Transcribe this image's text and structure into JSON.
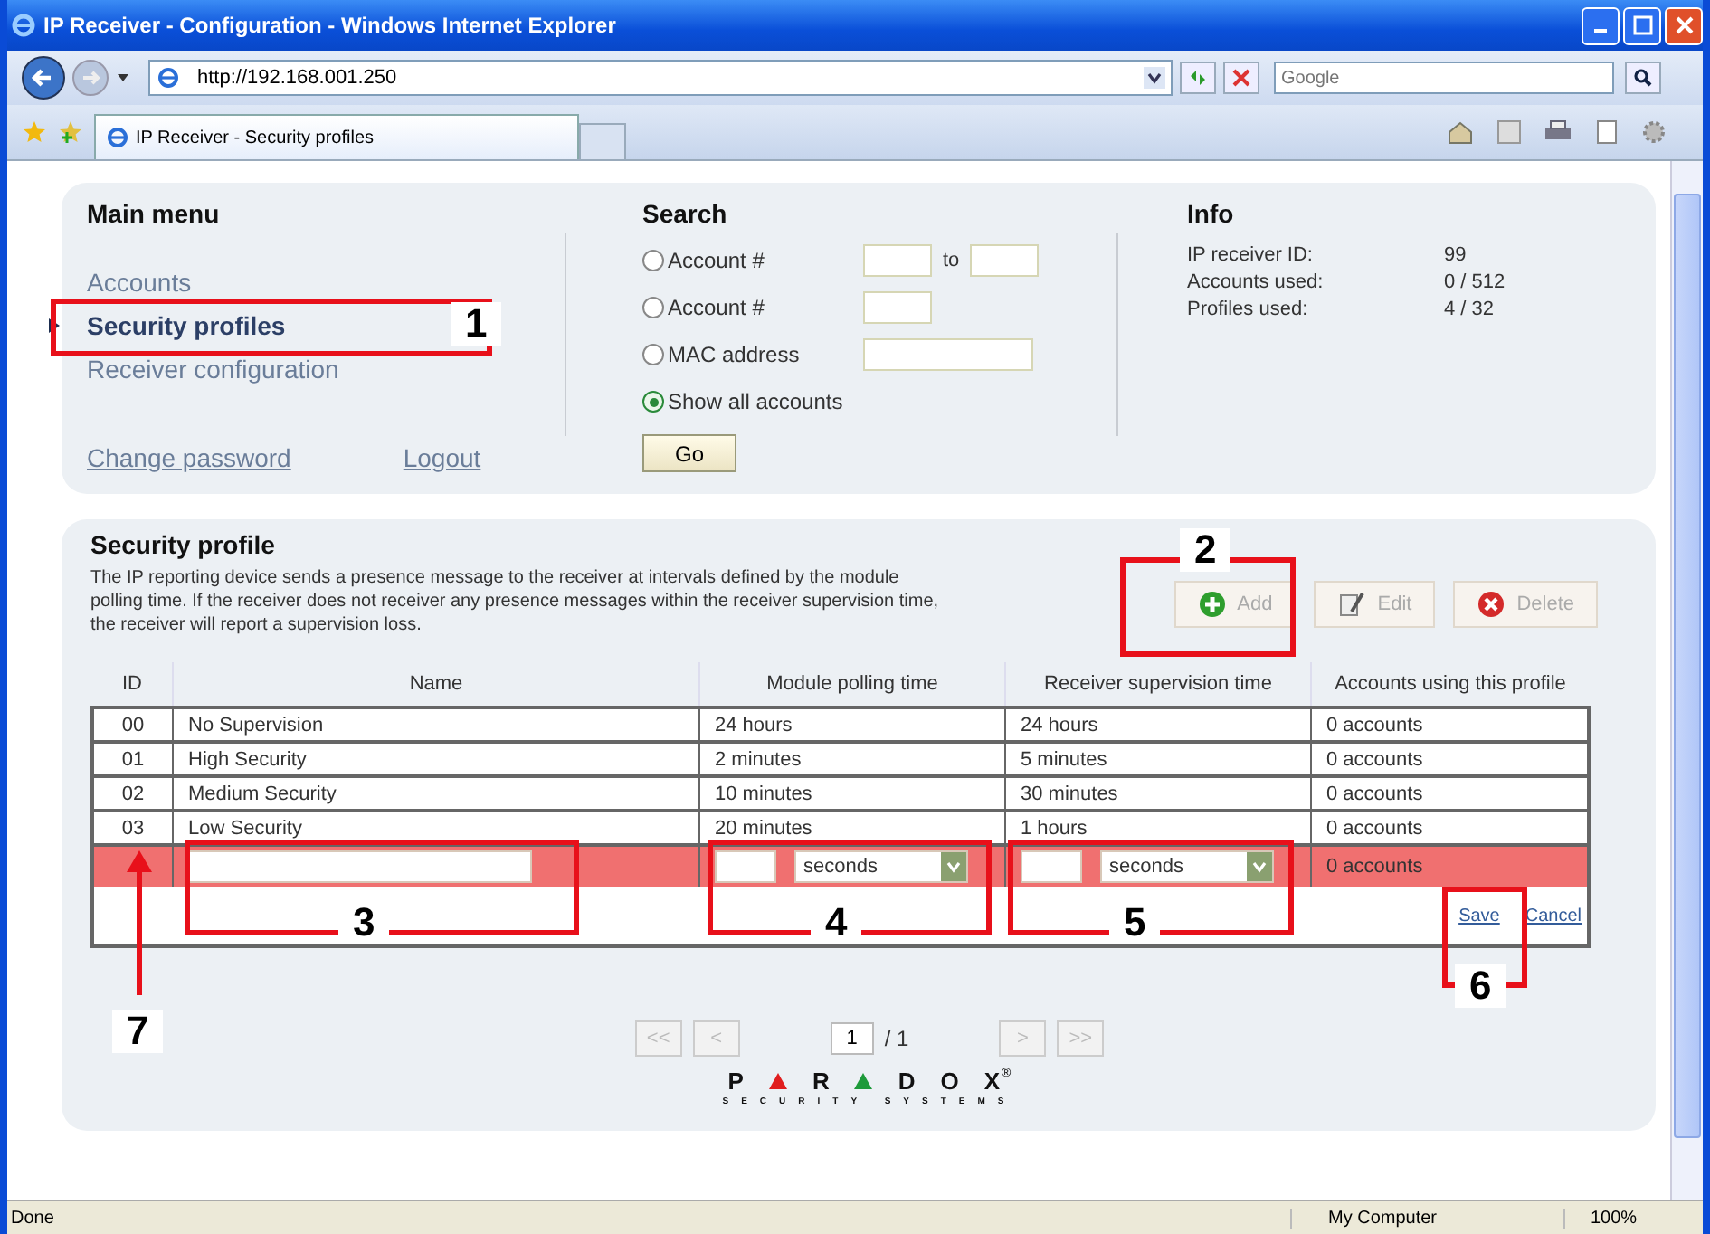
{
  "window": {
    "title": "IP Receiver - Configuration - Windows Internet Explorer"
  },
  "address_bar": {
    "url": "http://192.168.001.250",
    "search_placeholder": "Google"
  },
  "tabs": [
    {
      "label": "IP Receiver - Security profiles",
      "selected": true
    }
  ],
  "main_menu": {
    "title": "Main menu",
    "items": [
      {
        "label": "Accounts",
        "selected": false
      },
      {
        "label": "Security profiles",
        "selected": true
      },
      {
        "label": "Receiver configuration",
        "selected": false
      }
    ],
    "links": [
      "Change password",
      "Logout"
    ]
  },
  "search": {
    "title": "Search",
    "options": [
      {
        "label": "Account #",
        "selected": false,
        "kind": "range",
        "connector": "to"
      },
      {
        "label": "Account #",
        "selected": false,
        "kind": "single"
      },
      {
        "label": "MAC address",
        "selected": false,
        "kind": "wide"
      },
      {
        "label": "Show all accounts",
        "selected": true,
        "kind": "none"
      }
    ],
    "button": "Go"
  },
  "info": {
    "title": "Info",
    "rows": [
      {
        "label": "IP receiver ID:",
        "value": "99"
      },
      {
        "label": "Accounts used:",
        "value": "0 / 512"
      },
      {
        "label": "Profiles used:",
        "value": "4 / 32"
      }
    ]
  },
  "security_profile": {
    "title": "Security profile",
    "description": "The IP reporting device sends a presence message to the receiver at intervals defined by the module polling time. If the receiver does not receiver any presence messages within the receiver supervision time, the receiver will report a supervision loss.",
    "buttons": [
      {
        "label": "Add",
        "kind": "add"
      },
      {
        "label": "Edit",
        "kind": "edit"
      },
      {
        "label": "Delete",
        "kind": "delete"
      }
    ],
    "table": {
      "columns": [
        "ID",
        "Name",
        "Module polling time",
        "Receiver supervision time",
        "Accounts using this profile"
      ],
      "rows": [
        [
          "00",
          "No Supervision",
          "24 hours",
          "24 hours",
          "0 accounts"
        ],
        [
          "01",
          "High Security",
          "2 minutes",
          "5 minutes",
          "0 accounts"
        ],
        [
          "02",
          "Medium Security",
          "10 minutes",
          "30 minutes",
          "0 accounts"
        ],
        [
          "03",
          "Low Security",
          "20 minutes",
          "1 hours",
          "0 accounts"
        ]
      ],
      "new_row": {
        "polling_unit": "seconds",
        "supervision_unit": "seconds",
        "accounts": "0 accounts"
      },
      "actions": [
        "Save",
        "Cancel"
      ]
    }
  },
  "pagination": {
    "first": "<<",
    "prev": "<",
    "page": "1",
    "total": "/ 1",
    "next": ">",
    "last": ">>"
  },
  "logo": {
    "letters": [
      "P",
      "R",
      "D",
      "O",
      "X"
    ],
    "mark": "®",
    "tagline": "SECURITY SYSTEMS"
  },
  "status_bar": {
    "text": "Done",
    "zone": "My Computer",
    "zoom": "100%"
  },
  "annotations": [
    {
      "label": "1",
      "kind": "box"
    },
    {
      "label": "2",
      "kind": "box"
    },
    {
      "label": "3",
      "kind": "box"
    },
    {
      "label": "4",
      "kind": "box"
    },
    {
      "label": "5",
      "kind": "box"
    },
    {
      "label": "6",
      "kind": "box"
    },
    {
      "label": "7",
      "kind": "arrow"
    }
  ]
}
